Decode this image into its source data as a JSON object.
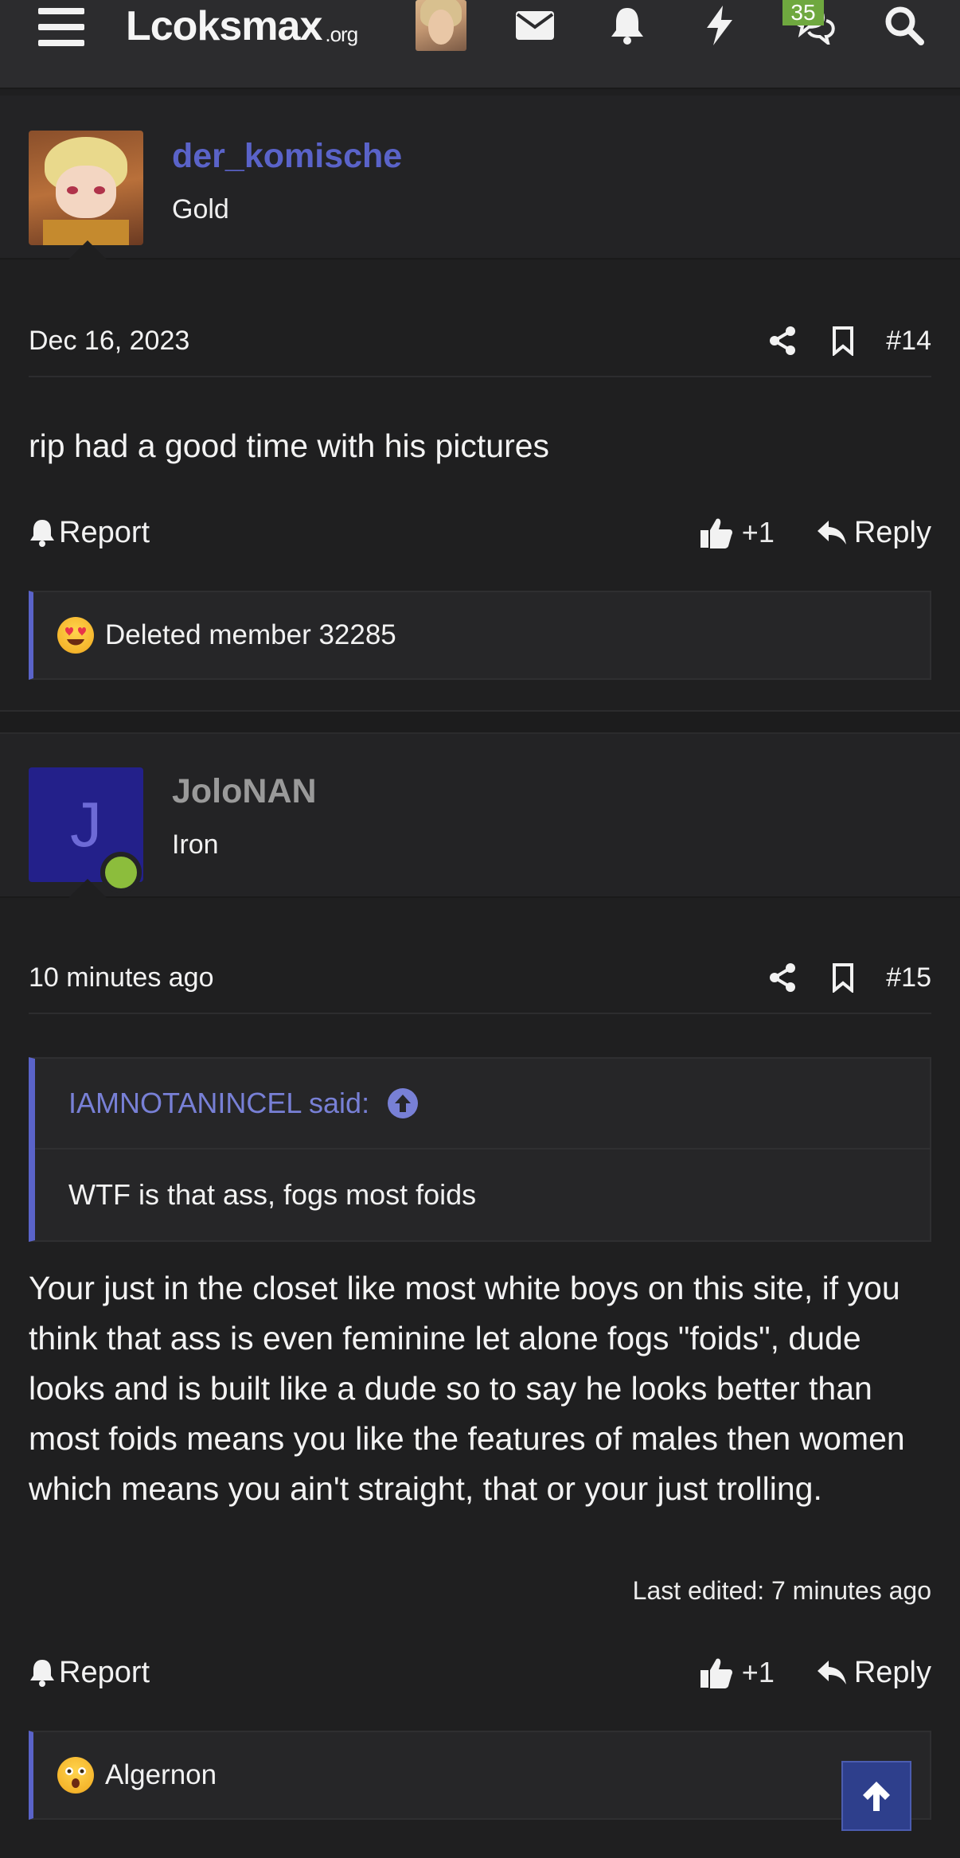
{
  "header": {
    "logo_main": "Lcoksmax",
    "logo_suffix": ".org",
    "conversations_badge": "35",
    "icons": [
      "menu-icon",
      "envelope-icon",
      "bell-icon",
      "lightning-icon",
      "chat-icon",
      "search-icon"
    ]
  },
  "posts": [
    {
      "username": "der_komische",
      "username_color": "#5a63c9",
      "rank": "Gold",
      "date": "Dec 16, 2023",
      "post_number": "#14",
      "body": "rip had a good time with his pictures",
      "report_label": "Report",
      "like_count": "+1",
      "reply_label": "Reply",
      "reaction_user": "Deleted member 32285",
      "reaction_emoji": "heart-eyes-emoji"
    },
    {
      "username": "JoloNAN",
      "username_color": "#9a9a9a",
      "avatar_letter": "J",
      "rank": "Iron",
      "date": "10 minutes ago",
      "post_number": "#15",
      "quote_author": "IAMNOTANINCEL said:",
      "quote_text": "WTF is that ass, fogs most foids",
      "body": "Your just in the closet like most white boys on this site, if you think that ass is even feminine let alone fogs \"foids\", dude looks and is built like a dude so to say he looks better than most foids means you like the features of males then women which means you ain't straight, that or your just trolling.",
      "last_edited": "Last edited: 7 minutes ago",
      "report_label": "Report",
      "like_count": "+1",
      "reply_label": "Reply",
      "reaction_user": "Algernon",
      "reaction_emoji": "shocked-emoji"
    }
  ],
  "colors": {
    "accent": "#5a63c9",
    "background": "#1f1f20",
    "online": "#8cbd3c",
    "badge": "#6fa83f"
  }
}
